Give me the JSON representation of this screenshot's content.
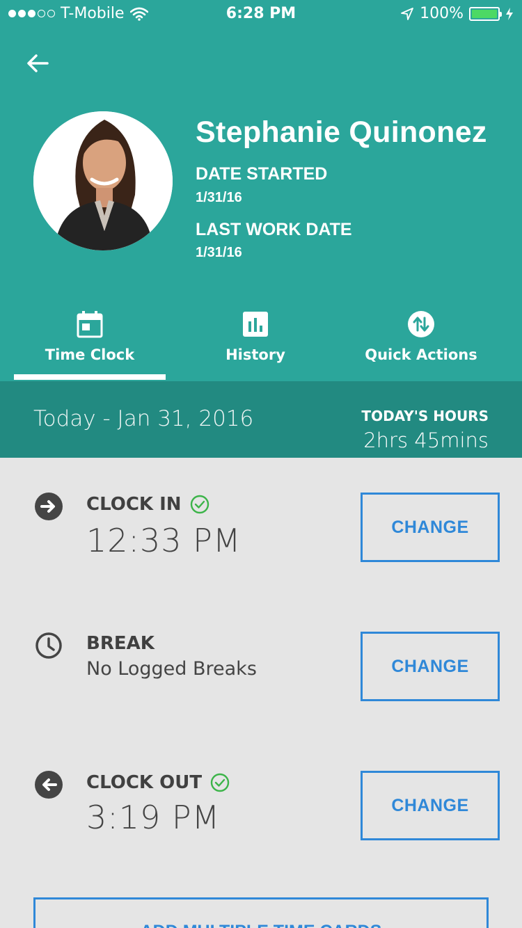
{
  "status_bar": {
    "carrier": "T-Mobile",
    "time": "6:28 PM",
    "battery": "100%",
    "signal_filled": 3,
    "signal_total": 5,
    "battery_fill_fraction": 1.0
  },
  "profile": {
    "name": "Stephanie Quinonez",
    "date_started_label": "DATE STARTED",
    "date_started": "1/31/16",
    "last_work_label": "LAST WORK DATE",
    "last_work_date": "1/31/16"
  },
  "tabs": [
    {
      "label": "Time Clock",
      "icon": "calendar-icon",
      "active": true
    },
    {
      "label": "History",
      "icon": "bar-chart-icon",
      "active": false
    },
    {
      "label": "Quick Actions",
      "icon": "swap-arrows-icon",
      "active": false
    }
  ],
  "summary": {
    "date": "Today - Jan 31, 2016",
    "hours_label": "TODAY'S HOURS",
    "hours_value": "2hrs 45mins"
  },
  "entries": {
    "clock_in": {
      "title": "CLOCK IN",
      "value": "12:33 PM",
      "verified": true,
      "button": "CHANGE"
    },
    "break": {
      "title": "BREAK",
      "value": "No Logged Breaks",
      "verified": false,
      "button": "CHANGE"
    },
    "clock_out": {
      "title": "CLOCK OUT",
      "value": "3:19 PM",
      "verified": true,
      "button": "CHANGE"
    }
  },
  "add_multiple_label": "ADD MULTIPLE TIME CARDS",
  "colors": {
    "header": "#2ba69b",
    "date_bar": "#228a81",
    "accent_blue": "#2f88d8",
    "verified_green": "#3cb449",
    "background": "#e5e5e5"
  }
}
